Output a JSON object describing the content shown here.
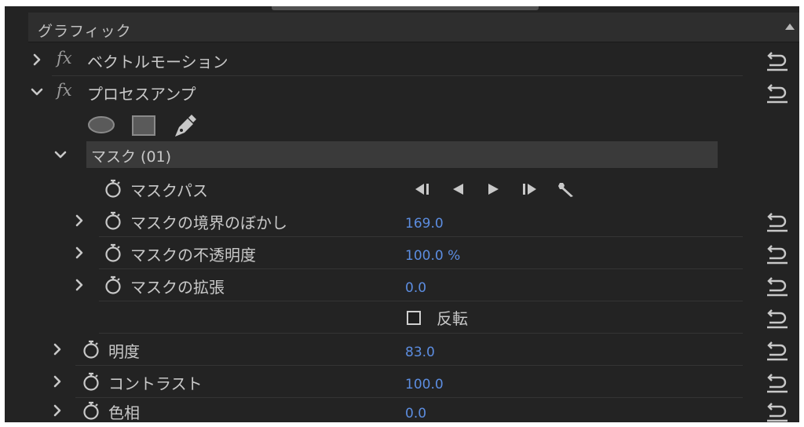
{
  "section": {
    "title": "グラフィック"
  },
  "effects": [
    {
      "label": "ベクトルモーション",
      "fx": "fx",
      "expanded": false
    },
    {
      "label": "プロセスアンプ",
      "fx": "fx",
      "expanded": true
    }
  ],
  "mask_tools": [
    "ellipse-mask-icon",
    "rectangle-mask-icon",
    "pen-mask-icon"
  ],
  "mask": {
    "label": "マスク (01)",
    "path_label": "マスクパス",
    "tracking_controls": [
      "track-backward-one-icon",
      "track-backward-icon",
      "track-forward-icon",
      "track-forward-one-icon",
      "tracking-settings-icon"
    ],
    "props": [
      {
        "label": "マスクの境界のぼかし",
        "value": "169.0"
      },
      {
        "label": "マスクの不透明度",
        "value": "100.0 %"
      },
      {
        "label": "マスクの拡張",
        "value": "0.0"
      }
    ],
    "invert_label": "反転",
    "invert_checked": false
  },
  "params": [
    {
      "label": "明度",
      "value": "83.0"
    },
    {
      "label": "コントラスト",
      "value": "100.0"
    },
    {
      "label": "色相",
      "value": "0.0"
    }
  ],
  "colors": {
    "panel_bg": "#232323",
    "value_blue": "#5c8de0",
    "text": "#c8c8c8"
  }
}
